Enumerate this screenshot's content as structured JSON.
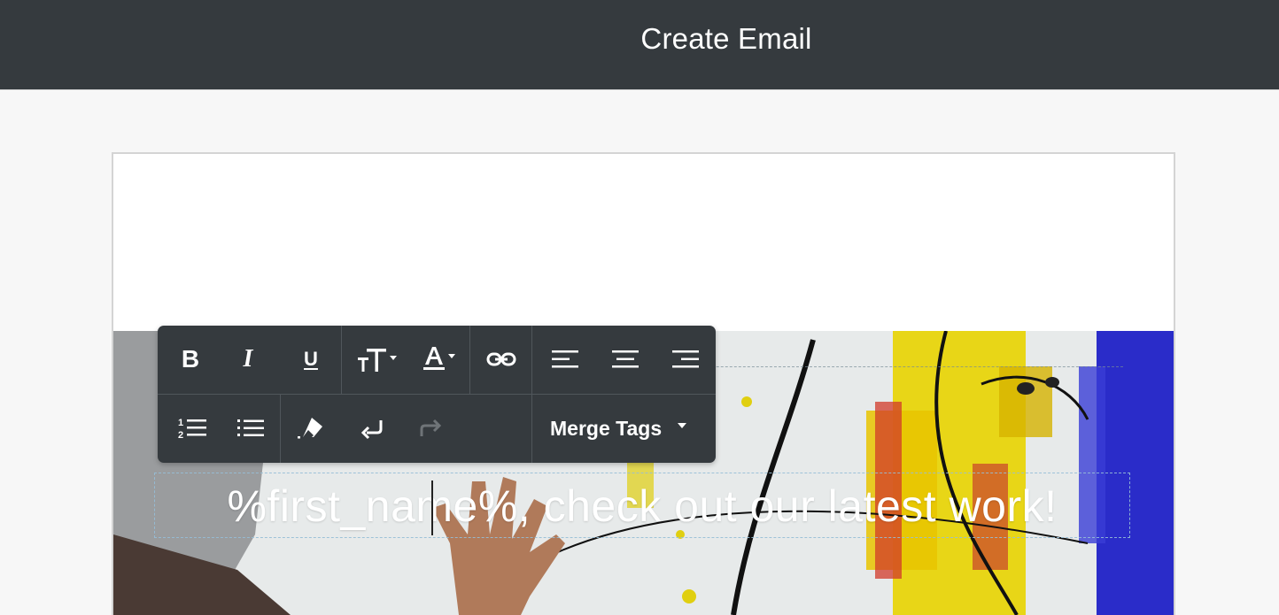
{
  "header": {
    "title": "Create Email"
  },
  "editor": {
    "headline": "%first_name%, check out our latest work!"
  },
  "toolbar": {
    "bold_label": "B",
    "italic_label": "I",
    "underline_label": "U",
    "merge_tags_label": "Merge Tags",
    "icons": [
      "bold-icon",
      "italic-icon",
      "underline-icon",
      "font-size-icon",
      "font-color-icon",
      "link-icon",
      "align-left-icon",
      "align-center-icon",
      "align-right-icon",
      "ordered-list-icon",
      "unordered-list-icon",
      "eraser-icon",
      "undo-icon",
      "redo-icon",
      "chevron-down-icon"
    ]
  },
  "colors": {
    "topbar": "#353a3e",
    "toolbar": "#353a3e",
    "page_bg": "#f7f7f7"
  }
}
